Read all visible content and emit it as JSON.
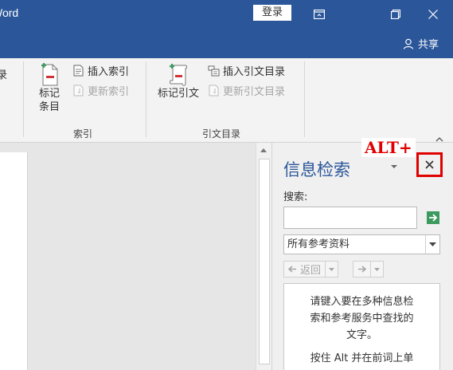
{
  "titlebar": {
    "app_title": "Word",
    "login_label": "登录"
  },
  "share": {
    "label": "共享"
  },
  "ribbon": {
    "left_partial_label": "录",
    "index_group": {
      "label": "索引",
      "mark_entry_line1": "标记",
      "mark_entry_line2": "条目",
      "insert_index": "插入索引",
      "update_index": "更新索引"
    },
    "toa_group": {
      "label": "引文目录",
      "mark_citation": "标记引文",
      "insert_toa": "插入引文目录",
      "update_toa": "更新引文目录"
    }
  },
  "research_pane": {
    "title": "信息检索",
    "annotation": "ALT+",
    "search_label": "搜索:",
    "search_value": "",
    "source_selected": "所有参考资料",
    "back_label": "返回",
    "hint_line1": "请键入要在多种信息检",
    "hint_line2": "索和参考服务中查找的",
    "hint_line3": "文字。",
    "tip_line1": "按住 Alt 并在前词上单"
  },
  "colors": {
    "title_bar": "#2b579a",
    "annotation_red": "#e00000",
    "go_green": "#3c9a5f"
  }
}
